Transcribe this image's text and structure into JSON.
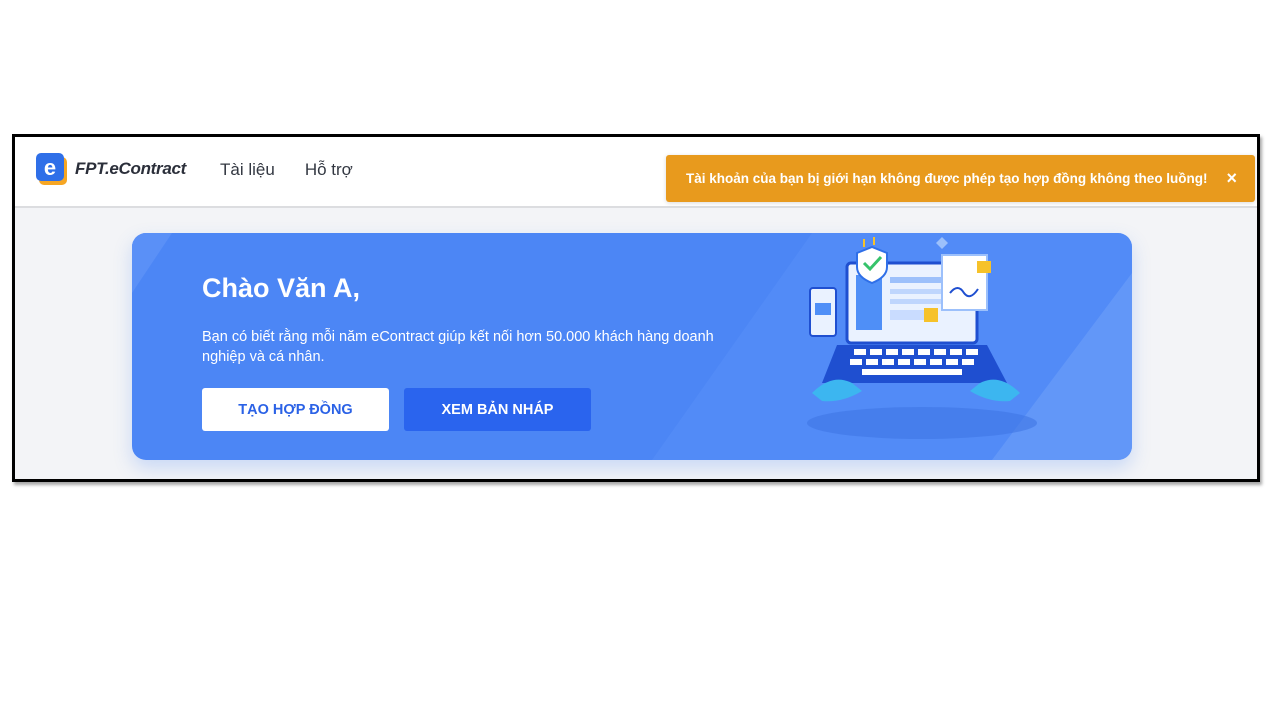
{
  "header": {
    "logo_text": "FPT.eContract",
    "nav": [
      {
        "label": "Tài liệu"
      },
      {
        "label": "Hỗ trợ"
      }
    ]
  },
  "toast": {
    "message": "Tài khoản của bạn bị giới hạn không được phép tạo hợp đồng không theo luồng!",
    "close_symbol": "×",
    "color": "#e89a1d"
  },
  "banner": {
    "greeting": "Chào Văn A,",
    "description": "Bạn có biết rằng mỗi năm eContract giúp kết nối hơn 50.000 khách hàng doanh nghiệp và cá nhân.",
    "primary_button": "TẠO HỢP ĐỒNG",
    "secondary_button": "XEM BẢN NHÁP",
    "background_color": "#4c86f5"
  }
}
